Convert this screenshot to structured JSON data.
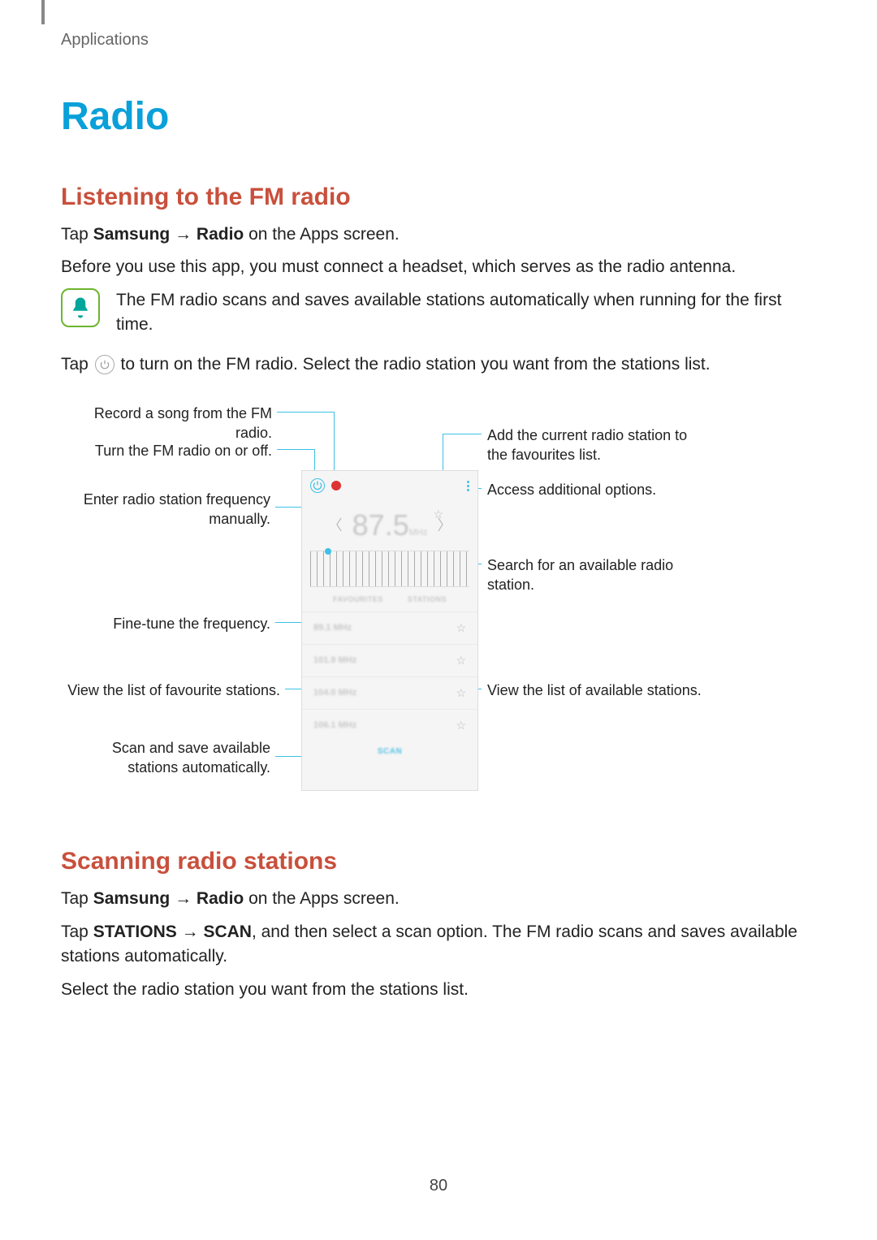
{
  "breadcrumb": "Applications",
  "title": "Radio",
  "section1": {
    "heading": "Listening to the FM radio",
    "p1_pre": "Tap ",
    "p1_bold1": "Samsung",
    "p1_arrow": " → ",
    "p1_bold2": "Radio",
    "p1_post": " on the Apps screen.",
    "p2": "Before you use this app, you must connect a headset, which serves as the radio antenna.",
    "note": "The FM radio scans and saves available stations automatically when running for the first time.",
    "p3_pre": "Tap ",
    "p3_post": " to turn on the FM radio. Select the radio station you want from the stations list."
  },
  "diagram": {
    "left": {
      "record": "Record a song from the FM radio.",
      "toggle": "Turn the FM radio on or off.",
      "manual": "Enter radio station frequency manually.",
      "finetune": "Fine-tune the frequency.",
      "favlist": "View the list of favourite stations.",
      "scan": "Scan and save available stations automatically."
    },
    "right": {
      "addfav": "Add the current radio station to the favourites list.",
      "options": "Access additional options.",
      "search": "Search for an available radio station.",
      "available": "View the list of available stations."
    },
    "phone": {
      "frequency": "87.5",
      "unit": "MHz",
      "tab_fav": "FAVOURITES",
      "tab_stations": "STATIONS",
      "stations": [
        "89.1 MHz",
        "101.9 MHz",
        "104.0 MHz",
        "106.1 MHz"
      ],
      "scan_label": "SCAN"
    }
  },
  "section2": {
    "heading": "Scanning radio stations",
    "p1_pre": "Tap ",
    "p1_bold1": "Samsung",
    "p1_arrow": " → ",
    "p1_bold2": "Radio",
    "p1_post": " on the Apps screen.",
    "p2_pre": "Tap ",
    "p2_bold1": "STATIONS",
    "p2_arrow": " → ",
    "p2_bold2": "SCAN",
    "p2_post": ", and then select a scan option. The FM radio scans and saves available stations automatically.",
    "p3": "Select the radio station you want from the stations list."
  },
  "page_number": "80"
}
